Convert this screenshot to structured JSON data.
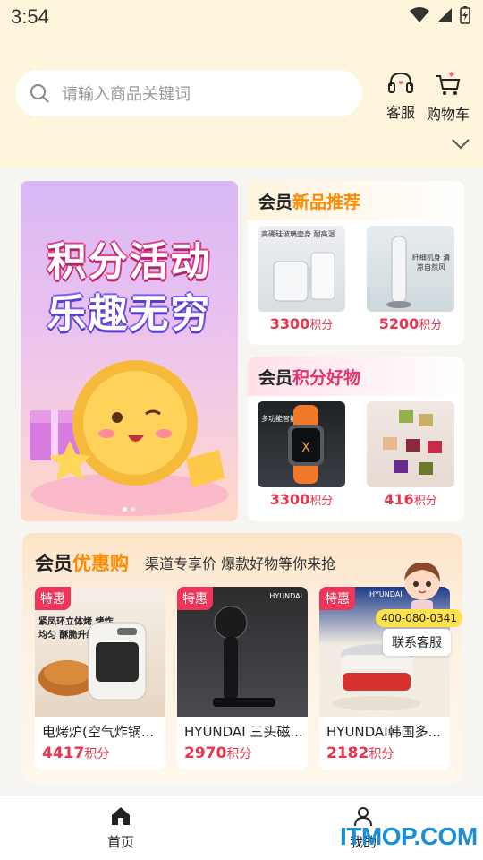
{
  "status_bar": {
    "time": "3:54"
  },
  "header": {
    "search": {
      "placeholder": "请输入商品关键词"
    },
    "service_label": "客服",
    "cart_label": "购物车"
  },
  "banner": {
    "line1": "积分活动",
    "line2": "乐趣无穷"
  },
  "new_card": {
    "title_prefix": "会员",
    "title_highlight": "新品推荐",
    "items": [
      {
        "points": "3300",
        "unit": "积分",
        "image_text": "高硼硅玻璃壶身 耐高温"
      },
      {
        "points": "5200",
        "unit": "积分",
        "image_text": "纤细机身 清凉自然风"
      }
    ]
  },
  "good_card": {
    "title_prefix": "会员",
    "title_highlight": "积分好物",
    "items": [
      {
        "points": "3300",
        "unit": "积分",
        "image_text": "多功能智能手表"
      },
      {
        "points": "416",
        "unit": "积分"
      }
    ]
  },
  "deal": {
    "title_prefix": "会员",
    "title_highlight": "优惠购",
    "subtitle": "渠道专享价 爆款好物等你来抢",
    "badge": "特惠",
    "items": [
      {
        "name": "电烤炉(空气炸锅...",
        "points": "4417",
        "unit": "积分",
        "image_text": "紧凤环立体烤 烤炸均匀 酥脆升级"
      },
      {
        "name": "HYUNDAI 三头磁...",
        "points": "2970",
        "unit": "积分",
        "image_text": "HYUNDAI"
      },
      {
        "name": "HYUNDAI韩国多...",
        "points": "2182",
        "unit": "积分",
        "image_text": "HYUNDAI"
      }
    ]
  },
  "customer_service": {
    "phone": "400-080-0341",
    "label": "联系客服"
  },
  "tabbar": {
    "home": "首页",
    "mine": "我的"
  },
  "watermark": "ITMOP.COM",
  "colors": {
    "accent": "#e8344e",
    "orange": "#ff8a00",
    "pink": "#e8316b",
    "header_bg": "#fdf5dc"
  }
}
